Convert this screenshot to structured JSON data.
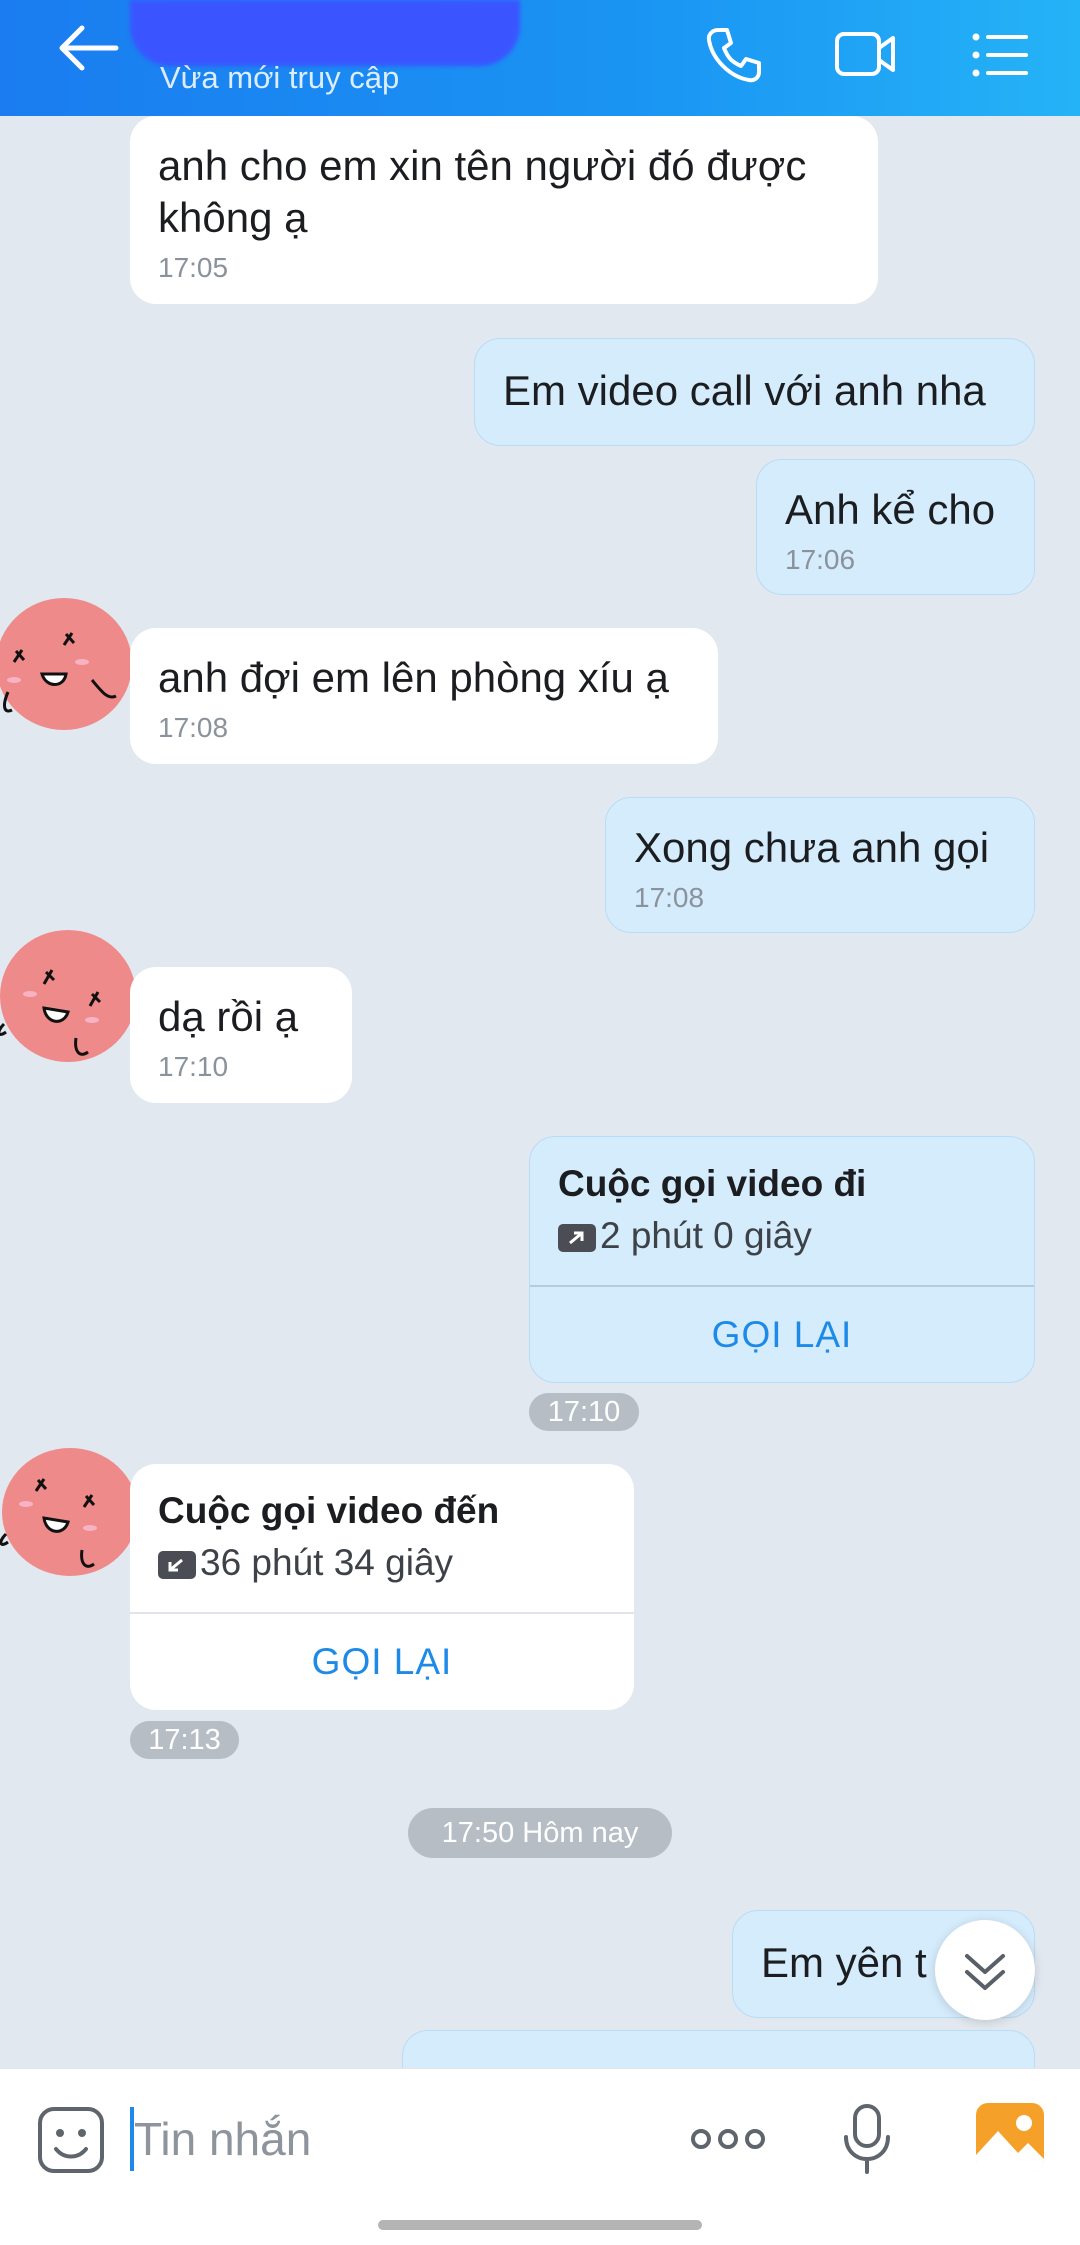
{
  "header": {
    "status": "Vừa mới truy cập",
    "back_icon": "arrow-left-icon",
    "call_icon": "phone-icon",
    "video_icon": "video-camera-icon",
    "menu_icon": "list-menu-icon"
  },
  "messages": [
    {
      "dir": "in",
      "text": "anh cho em xin tên người đó được\nkhông ạ",
      "time": "17:05"
    },
    {
      "dir": "out",
      "text": "Em video call với anh nha",
      "time": ""
    },
    {
      "dir": "out",
      "text": "Anh kể cho",
      "time": "17:06"
    },
    {
      "dir": "in",
      "text": "anh đợi em lên phòng xíu ạ",
      "time": "17:08"
    },
    {
      "dir": "out",
      "text": "Xong chưa anh gọi",
      "time": "17:08"
    },
    {
      "dir": "in",
      "text": "dạ rồi ạ",
      "time": "17:10"
    }
  ],
  "calls": [
    {
      "dir": "out",
      "title": "Cuộc gọi video đi",
      "duration": "2 phút 0 giây",
      "action": "GỌI LẠI",
      "time": "17:10"
    },
    {
      "dir": "in",
      "title": "Cuộc gọi video đến",
      "duration": "36 phút 34 giây",
      "action": "GỌI LẠI",
      "time": "17:13"
    }
  ],
  "date_separator": "17:50 Hôm nay",
  "last_message": {
    "dir": "out",
    "text": "Em yên t"
  },
  "composer": {
    "placeholder": "Tin nhắn",
    "emoji_icon": "emoji-icon",
    "more_icon": "more-dots-icon",
    "mic_icon": "microphone-icon",
    "gallery_icon": "gallery-icon",
    "scroll_icon": "double-chevron-down-icon"
  },
  "colors": {
    "header": "#1a7cf0",
    "outgoing_bubble": "#d5ecfc",
    "incoming_bubble": "#ffffff",
    "background": "#e2e8ef",
    "accent": "#1d8ae8"
  }
}
